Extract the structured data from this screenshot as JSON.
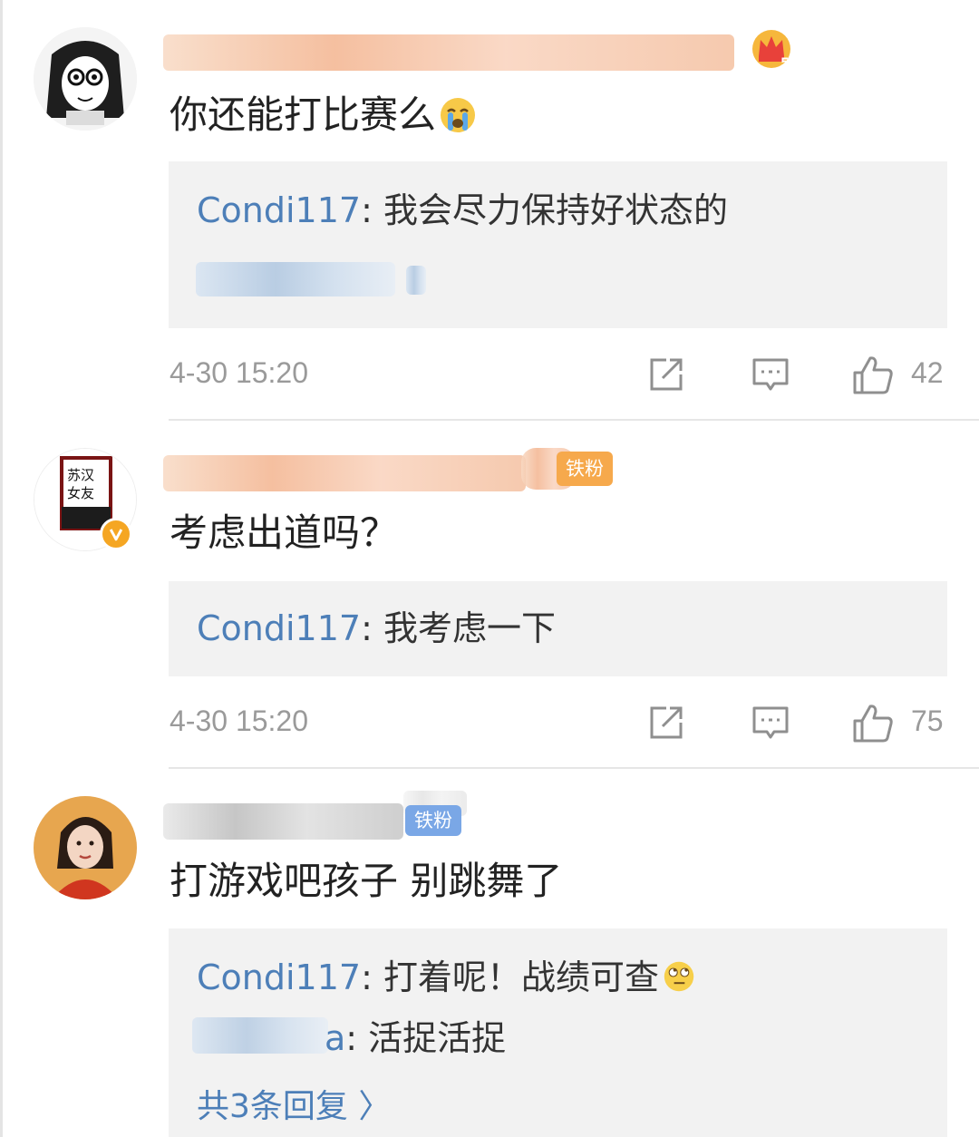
{
  "comments": [
    {
      "text": "你还能打比赛么",
      "emoji": "crying-emoji",
      "badge": null,
      "replies": [
        {
          "author": "Condi117",
          "text": ": 我会尽力保持好状态的"
        }
      ],
      "more_replies": "",
      "timestamp": "4-30 15:20",
      "likes": "42"
    },
    {
      "text": "考虑出道吗？",
      "badge": "铁粉",
      "verified": true,
      "replies": [
        {
          "author": "Condi117",
          "text": ": 我考虑一下"
        }
      ],
      "timestamp": "4-30 15:20",
      "likes": "75"
    },
    {
      "text": "打游戏吧孩子 别跳舞了",
      "badge": "铁粉",
      "replies": [
        {
          "author": "Condi117",
          "text": ": 打着呢！战绩可查",
          "emoji": "eye-roll-emoji"
        },
        {
          "author_suffix": "a",
          "text": ": 活捉活捉"
        }
      ],
      "more_replies": "共3条回复 〉"
    }
  ],
  "colors": {
    "link_blue": "#4d7fb8",
    "meta_gray": "#9a9a9a",
    "reply_bg": "#f2f2f2",
    "badge_orange": "#f6a94c",
    "badge_blue": "#7aa7e6"
  },
  "icons": [
    "share-icon",
    "comment-icon",
    "like-icon",
    "crown-icon",
    "verified-icon"
  ]
}
